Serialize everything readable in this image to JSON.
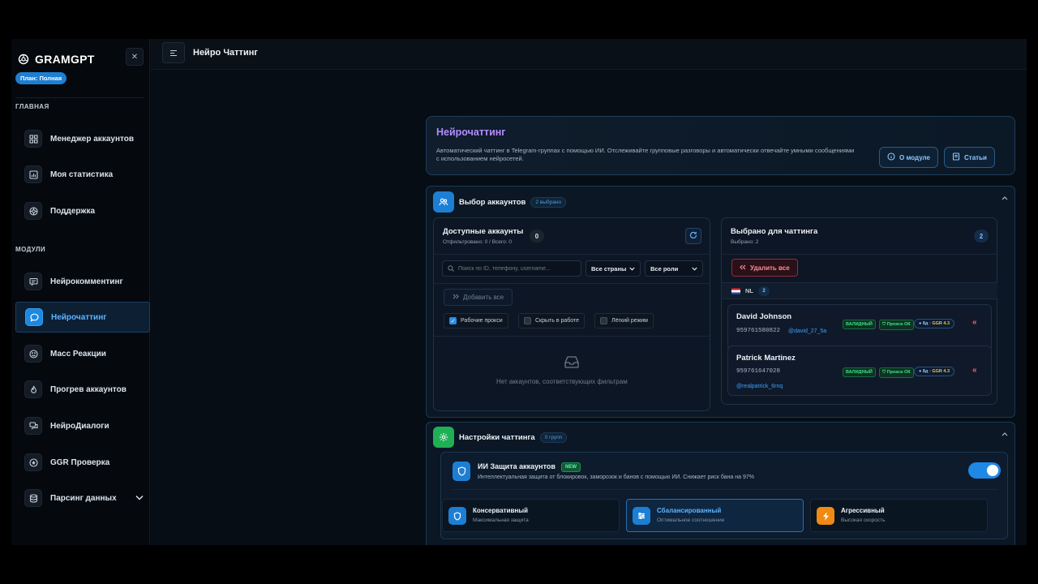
{
  "brand": {
    "name": "GRAMGPT",
    "plan": "План: Полная"
  },
  "sidebar": {
    "section_main": "ГЛАВНАЯ",
    "main_items": [
      {
        "label": "Менеджер аккаунтов",
        "icon": "grid-icon"
      },
      {
        "label": "Моя статистика",
        "icon": "chart-icon"
      },
      {
        "label": "Поддержка",
        "icon": "lifebuoy-icon"
      }
    ],
    "section_modules": "МОДУЛИ",
    "module_items": [
      {
        "label": "Нейрокомментинг",
        "icon": "comment-icon"
      },
      {
        "label": "Нейрочаттинг",
        "icon": "chat-bubble-icon"
      },
      {
        "label": "Масс Реакции",
        "icon": "smile-icon"
      },
      {
        "label": "Прогрев аккаунтов",
        "icon": "flame-icon"
      },
      {
        "label": "НейроДиалоги",
        "icon": "dialogs-icon"
      },
      {
        "label": "GGR Проверка",
        "icon": "star-icon"
      },
      {
        "label": "Парсинг данных",
        "icon": "database-icon"
      }
    ]
  },
  "topbar": {
    "title": "Нейро Чаттинг"
  },
  "header": {
    "title": "Нейрочаттинг",
    "description": "Автоматический чаттинг в Telegram-группах с помощью ИИ. Отслеживайте групповые разговоры и автоматически отвечайте умными сообщениями с использованием нейросетей.",
    "about_label": "О модуле",
    "articles_label": "Статьи"
  },
  "accounts_section": {
    "title": "Выбор аккаунтов",
    "badge": "2 выбрано",
    "available": {
      "title": "Доступные аккаунты",
      "subtitle": "Отфильтровано: 0 / Всего: 0",
      "count": "0",
      "search_placeholder": "Поиск по ID, телефону, username...",
      "country_select": "Все страны",
      "role_select": "Все роли",
      "add_all_label": "Добавить все",
      "filters": [
        {
          "label": "Рабочие прокси",
          "checked": true
        },
        {
          "label": "Скрыть в работе",
          "checked": false
        },
        {
          "label": "Лёгкий режим",
          "checked": false
        }
      ],
      "empty_text": "Нет аккаунтов, соответствующих фильтрам"
    },
    "selected": {
      "title": "Выбрано для чаттинга",
      "subtitle": "Выбрано: 2",
      "count": "2",
      "remove_all_label": "Удалить все",
      "group": {
        "country": "NL",
        "count": "2"
      },
      "accounts": [
        {
          "name": "David Johnson",
          "phone": "959761580822",
          "username": "@david_27_5a",
          "status": "ВАЛИДНЫЙ",
          "proxy": "Прокси ОК",
          "age": "8д",
          "ggr_label": "GGR",
          "ggr": "4.3"
        },
        {
          "name": "Patrick Martinez",
          "phone": "959761647028",
          "username": "@realpatrick_6rnq",
          "status": "ВАЛИДНЫЙ",
          "proxy": "Прокси ОК",
          "age": "8д",
          "ggr_label": "GGR",
          "ggr": "4.3"
        }
      ]
    }
  },
  "settings_section": {
    "title": "Настройки чаттинга",
    "badge": "0 групп",
    "ai_protection": {
      "title": "ИИ Защита аккаунтов",
      "badge": "NEW",
      "description": "Интеллектуальная защита от блокировок, заморозок и банов с помощью ИИ. Снижает риск бана на 97%",
      "enabled": true
    },
    "modes": [
      {
        "title": "Консервативный",
        "subtitle": "Максимальная защита",
        "color": "#1d7fd4",
        "icon": "shield-icon"
      },
      {
        "title": "Сбалансированный",
        "subtitle": "Оптимальное соотношение",
        "color": "#1d7fd4",
        "icon": "sliders-icon",
        "active": true
      },
      {
        "title": "Агрессивный",
        "subtitle": "Высокая скорость",
        "color": "#f08a12",
        "icon": "bolt-icon"
      }
    ]
  },
  "colors": {
    "accent": "#1d88e0",
    "purple_title": "#b48cff",
    "danger": "#ff5d6c",
    "success": "#3fe08c"
  }
}
